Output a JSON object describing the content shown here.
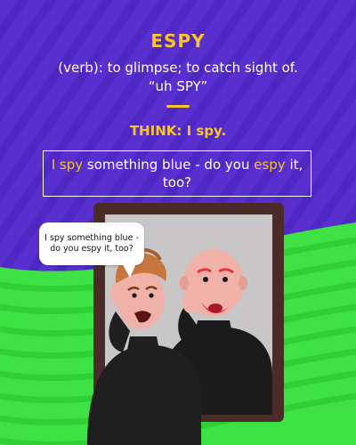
{
  "word": "ESPY",
  "definition_line": "(verb): to glimpse; to catch sight of.",
  "pronunciation": "“uh SPY”",
  "think": "THINK: I spy.",
  "example": {
    "part1": "I spy",
    "part2": " something blue - do you ",
    "part3": "espy",
    "part4": " it, too?"
  },
  "speech_bubble": "I spy something blue - do you espy it, too?",
  "colors": {
    "background_purple": "#5a2fd0",
    "background_green": "#3ee244",
    "accent_yellow": "#f7c429",
    "mirror_frame": "#4a2b28"
  }
}
